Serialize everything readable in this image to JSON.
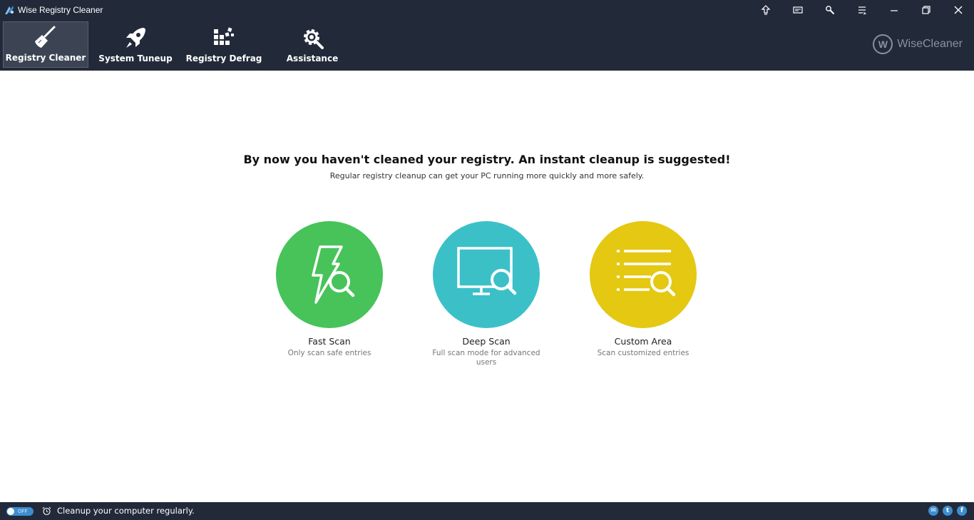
{
  "window": {
    "title": "Wise Registry Cleaner"
  },
  "tabs": [
    {
      "label": "Registry Cleaner",
      "icon": "broom-icon",
      "active": true
    },
    {
      "label": "System Tuneup",
      "icon": "rocket-icon",
      "active": false
    },
    {
      "label": "Registry Defrag",
      "icon": "defrag-icon",
      "active": false
    },
    {
      "label": "Assistance",
      "icon": "gear-wrench-icon",
      "active": false
    }
  ],
  "brand": {
    "logo_letter": "W",
    "name": "WiseCleaner"
  },
  "main": {
    "headline": "By now you haven't cleaned your registry. An instant cleanup is suggested!",
    "subline": "Regular registry cleanup can get your PC running more quickly and more safely."
  },
  "scan_options": [
    {
      "label": "Fast Scan",
      "desc": "Only scan safe entries",
      "color": "#47c35a",
      "icon": "lightning-search-icon"
    },
    {
      "label": "Deep Scan",
      "desc": "Full scan mode for advanced users",
      "color": "#3cc0c8",
      "icon": "monitor-search-icon"
    },
    {
      "label": "Custom Area",
      "desc": "Scan customized entries",
      "color": "#e4c812",
      "icon": "list-search-icon"
    }
  ],
  "statusbar": {
    "toggle_label": "OFF",
    "message": "Cleanup your computer regularly."
  },
  "colors": {
    "titlebar_bg": "#222a3a",
    "active_tab_bg": "#3c4454",
    "accent_blue": "#3d8ed0"
  }
}
